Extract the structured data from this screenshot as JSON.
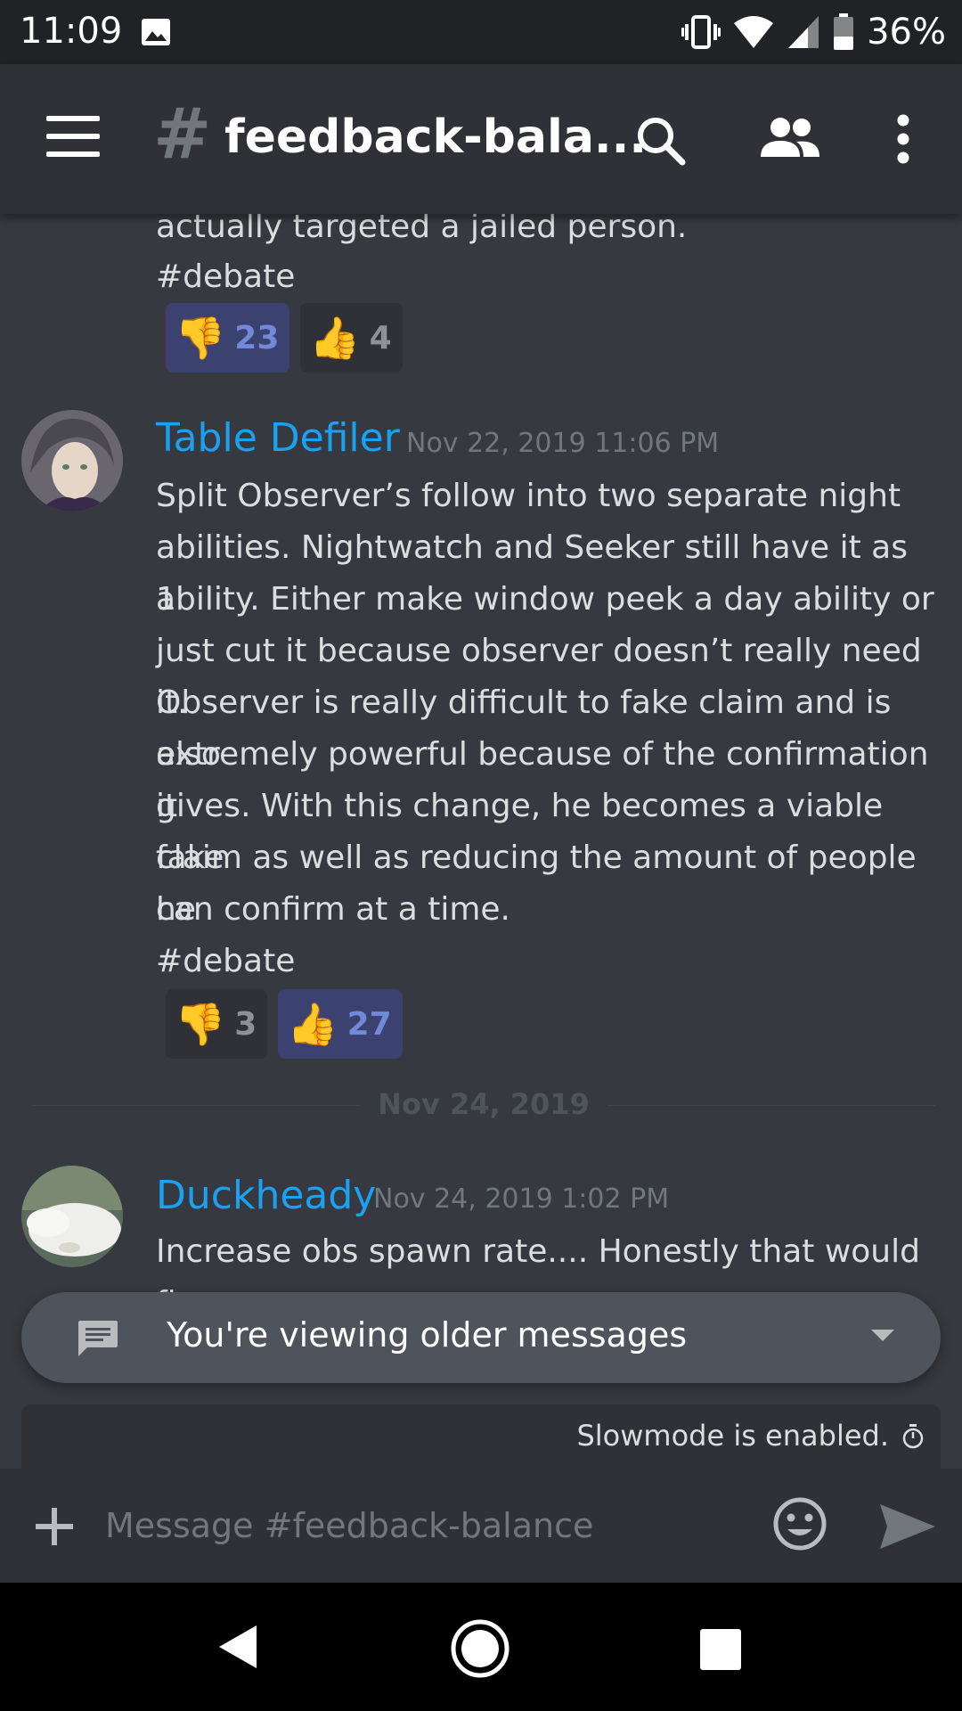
{
  "status_bar": {
    "time": "11:09",
    "battery_percent": "36%"
  },
  "header": {
    "hash": "#",
    "channel_name": "feedback-bala..."
  },
  "messages": {
    "top_partial": {
      "text_line": "actually targeted a jailed person.",
      "tag": "#debate",
      "reactions": [
        {
          "emoji": "👎",
          "count": "23",
          "active": true
        },
        {
          "emoji": "👍",
          "count": "4",
          "active": false
        }
      ]
    },
    "message_1": {
      "author": "Table Defiler",
      "timestamp": "Nov 22, 2019 11:06 PM",
      "lines": [
        "Split Observer’s follow into two separate night",
        "abilities. Nightwatch and Seeker still have it as 1",
        "ability. Either make window peek a day ability or",
        "just cut it because observer doesn’t really need it.",
        "Observer is really difficult to fake claim and is also",
        "extremely powerful because of the confirmation it",
        "gives. With this change, he becomes a viable fake",
        "claim as well as reducing the amount of people he",
        "can confirm at a time."
      ],
      "tag": "#debate",
      "reactions": [
        {
          "emoji": "👎",
          "count": "3",
          "active": false
        },
        {
          "emoji": "👍",
          "count": "27",
          "active": true
        }
      ]
    },
    "date_divider": "Nov 24, 2019",
    "message_2": {
      "author": "Duckheady",
      "timestamp": "Nov 24, 2019 1:02 PM",
      "text": "Increase obs spawn rate.... Honestly that would fix"
    }
  },
  "older_banner": {
    "text": "You're viewing older messages"
  },
  "slowmode": {
    "text": "Slowmode is enabled."
  },
  "composer": {
    "placeholder": "Message #feedback-balance"
  },
  "colors": {
    "author": "#1ba1f2",
    "background": "#36393f",
    "header": "#2f3136",
    "reaction_active": "#3c4270",
    "reaction_active_text": "#7289da"
  }
}
